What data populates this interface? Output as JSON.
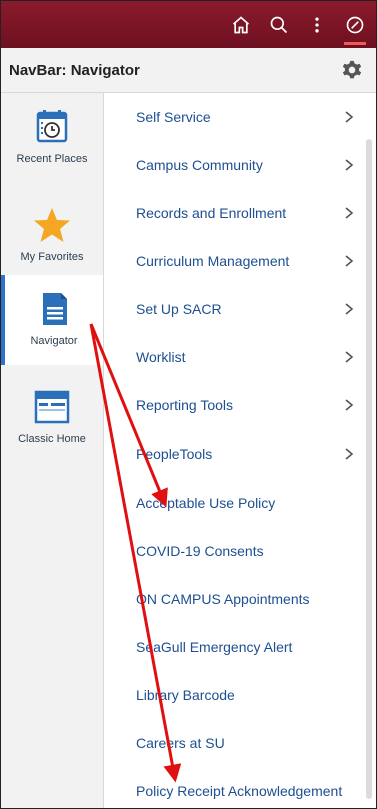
{
  "topbar": {
    "icons": [
      "home-icon",
      "search-icon",
      "more-icon",
      "navigator-compass-icon"
    ]
  },
  "header": {
    "title": "NavBar: Navigator"
  },
  "sidebar": {
    "items": [
      {
        "label": "Recent Places",
        "icon": "calendar-clock-icon"
      },
      {
        "label": "My Favorites",
        "icon": "star-icon"
      },
      {
        "label": "Navigator",
        "icon": "document-icon"
      },
      {
        "label": "Classic Home",
        "icon": "browser-window-icon"
      }
    ]
  },
  "menu": {
    "items": [
      {
        "label": "Self Service",
        "chevron": true
      },
      {
        "label": "Campus Community",
        "chevron": true
      },
      {
        "label": "Records and Enrollment",
        "chevron": true
      },
      {
        "label": "Curriculum Management",
        "chevron": true
      },
      {
        "label": "Set Up SACR",
        "chevron": true
      },
      {
        "label": "Worklist",
        "chevron": true
      },
      {
        "label": "Reporting Tools",
        "chevron": true
      },
      {
        "label": "PeopleTools",
        "chevron": true
      },
      {
        "label": "Acceptable Use Policy",
        "chevron": false
      },
      {
        "label": "COVID-19 Consents",
        "chevron": false
      },
      {
        "label": "ON CAMPUS Appointments",
        "chevron": false
      },
      {
        "label": "SeaGull Emergency Alert",
        "chevron": false
      },
      {
        "label": "Library Barcode",
        "chevron": false
      },
      {
        "label": "Careers at SU",
        "chevron": false
      },
      {
        "label": "Policy Receipt Acknowledgement",
        "chevron": false
      }
    ]
  },
  "colors": {
    "topbar": "#7a1526",
    "accent": "#2f72c7",
    "link": "#1d4f91",
    "star": "#f5a623",
    "annotation": "#e01010"
  }
}
